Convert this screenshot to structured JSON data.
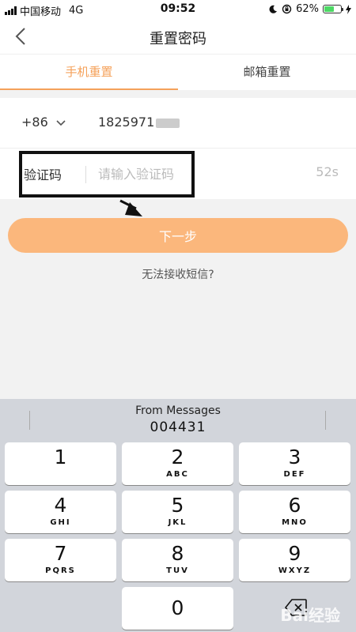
{
  "status_bar": {
    "carrier": "中国移动",
    "network": "4G",
    "time": "09:52",
    "battery": "62%",
    "battery_level": 0.62
  },
  "nav": {
    "title": "重置密码"
  },
  "tabs": [
    {
      "label": "手机重置",
      "active": true
    },
    {
      "label": "邮箱重置",
      "active": false
    }
  ],
  "form": {
    "country_code": "+86",
    "phone_number": "1825971",
    "code_label": "验证码",
    "code_placeholder": "请输入验证码",
    "code_value": "",
    "countdown": "52s"
  },
  "next_button": {
    "label": "下一步"
  },
  "sms_help": {
    "label": "无法接收短信?"
  },
  "keyboard": {
    "suggestion_source": "From Messages",
    "suggestion_code": "004431",
    "keys": [
      {
        "num": "1",
        "letters": ""
      },
      {
        "num": "2",
        "letters": "ABC"
      },
      {
        "num": "3",
        "letters": "DEF"
      },
      {
        "num": "4",
        "letters": "GHI"
      },
      {
        "num": "5",
        "letters": "JKL"
      },
      {
        "num": "6",
        "letters": "MNO"
      },
      {
        "num": "7",
        "letters": "PQRS"
      },
      {
        "num": "8",
        "letters": "TUV"
      },
      {
        "num": "9",
        "letters": "WXYZ"
      },
      {
        "num": "0",
        "letters": ""
      }
    ]
  },
  "watermark": "Bai经验",
  "colors": {
    "accent": "#f5a15a",
    "button": "#fbb77c",
    "keyboard_bg": "#d2d5db"
  }
}
